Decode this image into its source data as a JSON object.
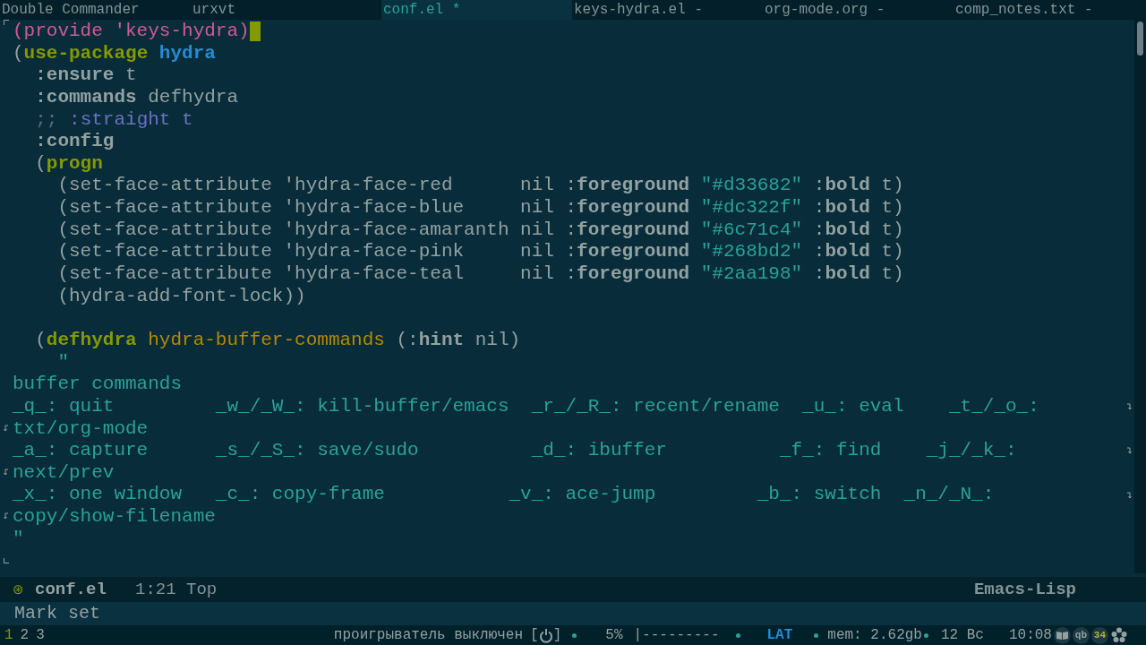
{
  "tabs": [
    {
      "label": "Double Commander",
      "selected": false
    },
    {
      "label": "urxvt",
      "selected": false
    },
    {
      "label": "conf.el *",
      "selected": true
    },
    {
      "label": "keys-hydra.el -",
      "selected": false
    },
    {
      "label": "org-mode.org -",
      "selected": false
    },
    {
      "label": "comp_notes.txt -",
      "selected": false
    }
  ],
  "editor": {
    "lines": [
      {
        "cursor": true,
        "segments": [
          {
            "text": "(provide 'keys-hydra)",
            "kind": "provide"
          }
        ]
      },
      {
        "segments": [
          {
            "text": "(",
            "kind": "plain"
          },
          {
            "text": "use-package",
            "kind": "keyword"
          },
          {
            "text": " hydra",
            "kind": "name"
          }
        ]
      },
      {
        "segments": [
          {
            "text": "  :ensure",
            "kind": "bold"
          },
          {
            "text": " t",
            "kind": "plain"
          }
        ]
      },
      {
        "segments": [
          {
            "text": "  :commands",
            "kind": "bold"
          },
          {
            "text": " defhydra",
            "kind": "plain"
          }
        ]
      },
      {
        "segments": [
          {
            "text": "  ;;",
            "kind": "comment"
          },
          {
            "text": " :straight t",
            "kind": "doc"
          }
        ]
      },
      {
        "segments": [
          {
            "text": "  :config",
            "kind": "bold"
          }
        ]
      },
      {
        "segments": [
          {
            "text": "  (",
            "kind": "plain"
          },
          {
            "text": "progn",
            "kind": "keyword"
          }
        ]
      },
      {
        "segments": [
          {
            "text": "    (set-face-attribute 'hydra-face-red      nil :",
            "kind": "plain"
          },
          {
            "text": "foreground",
            "kind": "bold"
          },
          {
            "text": " \"#d33682\"",
            "kind": "string"
          },
          {
            "text": " :",
            "kind": "plain"
          },
          {
            "text": "bold",
            "kind": "bold"
          },
          {
            "text": " t)",
            "kind": "plain"
          }
        ]
      },
      {
        "segments": [
          {
            "text": "    (set-face-attribute 'hydra-face-blue     nil :",
            "kind": "plain"
          },
          {
            "text": "foreground",
            "kind": "bold"
          },
          {
            "text": " \"#dc322f\"",
            "kind": "string"
          },
          {
            "text": " :",
            "kind": "plain"
          },
          {
            "text": "bold",
            "kind": "bold"
          },
          {
            "text": " t)",
            "kind": "plain"
          }
        ]
      },
      {
        "segments": [
          {
            "text": "    (set-face-attribute 'hydra-face-amaranth nil :",
            "kind": "plain"
          },
          {
            "text": "foreground",
            "kind": "bold"
          },
          {
            "text": " \"#6c71c4\"",
            "kind": "string"
          },
          {
            "text": " :",
            "kind": "plain"
          },
          {
            "text": "bold",
            "kind": "bold"
          },
          {
            "text": " t)",
            "kind": "plain"
          }
        ]
      },
      {
        "segments": [
          {
            "text": "    (set-face-attribute 'hydra-face-pink     nil :",
            "kind": "plain"
          },
          {
            "text": "foreground",
            "kind": "bold"
          },
          {
            "text": " \"#268bd2\"",
            "kind": "string"
          },
          {
            "text": " :",
            "kind": "plain"
          },
          {
            "text": "bold",
            "kind": "bold"
          },
          {
            "text": " t)",
            "kind": "plain"
          }
        ]
      },
      {
        "segments": [
          {
            "text": "    (set-face-attribute 'hydra-face-teal     nil :",
            "kind": "plain"
          },
          {
            "text": "foreground",
            "kind": "bold"
          },
          {
            "text": " \"#2aa198\"",
            "kind": "string"
          },
          {
            "text": " :",
            "kind": "plain"
          },
          {
            "text": "bold",
            "kind": "bold"
          },
          {
            "text": " t)",
            "kind": "plain"
          }
        ]
      },
      {
        "segments": [
          {
            "text": "    (hydra-add-font-lock))",
            "kind": "plain"
          }
        ]
      },
      {
        "kind": "blank"
      },
      {
        "segments": [
          {
            "text": "  (",
            "kind": "plain"
          },
          {
            "text": "defhydra",
            "kind": "keyword"
          },
          {
            "text": " hydra-buffer-commands",
            "kind": "function"
          },
          {
            "text": " (:",
            "kind": "plain"
          },
          {
            "text": "hint",
            "kind": "bold"
          },
          {
            "text": " nil)",
            "kind": "plain"
          }
        ]
      },
      {
        "segments": [
          {
            "text": "    \"",
            "kind": "string"
          }
        ]
      },
      {
        "segments": [
          {
            "text": "buffer commands",
            "kind": "string"
          }
        ]
      },
      {
        "wrapped": true,
        "segments": [
          {
            "text": "_q_: quit         _w_/_W_: kill-buffer/emacs  _r_/_R_: recent/rename  _u_: eval    _t_/_o_:",
            "kind": "string"
          }
        ]
      },
      {
        "continued": true,
        "segments": [
          {
            "text": "txt/org-mode",
            "kind": "string"
          }
        ]
      },
      {
        "wrapped": true,
        "segments": [
          {
            "text": "_a_: capture      _s_/_S_: save/sudo          _d_: ibuffer          _f_: find    _j_/_k_:",
            "kind": "string"
          }
        ]
      },
      {
        "continued": true,
        "segments": [
          {
            "text": "next/prev",
            "kind": "string"
          }
        ]
      },
      {
        "wrapped": true,
        "segments": [
          {
            "text": "_x_: one window   _c_: copy-frame           _v_: ace-jump         _b_: switch  _n_/_N_:",
            "kind": "string"
          }
        ]
      },
      {
        "continued": true,
        "segments": [
          {
            "text": "copy/show-filename",
            "kind": "string"
          }
        ]
      },
      {
        "segments": [
          {
            "text": "\"",
            "kind": "string"
          }
        ]
      }
    ]
  },
  "mode_line": {
    "modified": "⊛",
    "buffer": "conf.el",
    "position": "1:21 Top",
    "mode": "Emacs-Lisp"
  },
  "echo_area": "Mark set",
  "panel": {
    "workspaces": [
      {
        "label": "1",
        "selected": true
      },
      {
        "label": "2",
        "selected": false
      },
      {
        "label": "3",
        "selected": false
      }
    ],
    "player": "проигрыватель выключен",
    "bracket_open": "[",
    "bracket_close": "]",
    "volume": "5%",
    "volume_bar": "|---------",
    "layout": "LAT",
    "memory": "mem: 2.62gb",
    "date": "12 Вс",
    "time": "10:08",
    "tray_qb": "qb",
    "tray_count": "34"
  }
}
